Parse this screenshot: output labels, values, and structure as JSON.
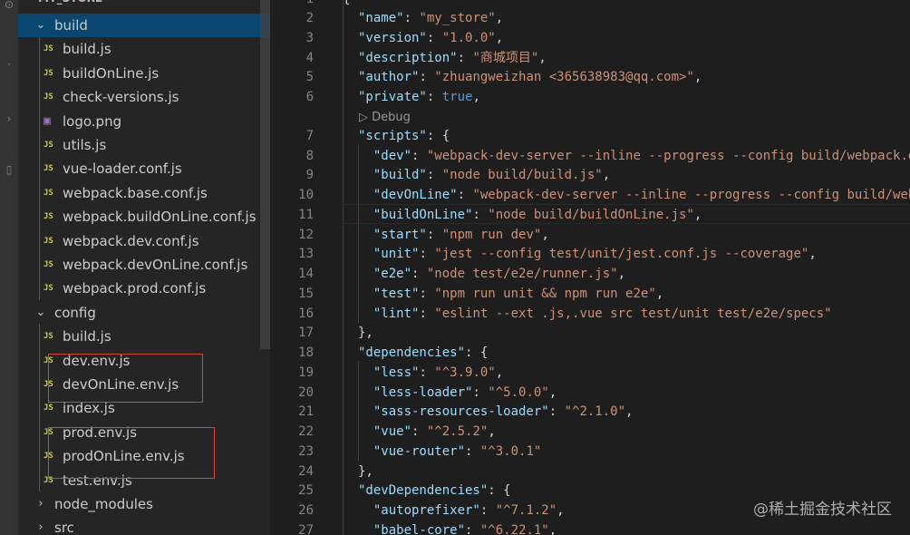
{
  "explorer": {
    "root_label": "MY_STORE",
    "items": [
      {
        "type": "folder",
        "label": "build",
        "open": true,
        "depth": 0,
        "selected": true
      },
      {
        "type": "js",
        "label": "build.js",
        "depth": 1
      },
      {
        "type": "js",
        "label": "buildOnLine.js",
        "depth": 1
      },
      {
        "type": "js",
        "label": "check-versions.js",
        "depth": 1
      },
      {
        "type": "png",
        "label": "logo.png",
        "depth": 1
      },
      {
        "type": "js",
        "label": "utils.js",
        "depth": 1
      },
      {
        "type": "js",
        "label": "vue-loader.conf.js",
        "depth": 1
      },
      {
        "type": "js",
        "label": "webpack.base.conf.js",
        "depth": 1
      },
      {
        "type": "js",
        "label": "webpack.buildOnLine.conf.js",
        "depth": 1
      },
      {
        "type": "js",
        "label": "webpack.dev.conf.js",
        "depth": 1
      },
      {
        "type": "js",
        "label": "webpack.devOnLine.conf.js",
        "depth": 1
      },
      {
        "type": "js",
        "label": "webpack.prod.conf.js",
        "depth": 1
      },
      {
        "type": "folder",
        "label": "config",
        "open": true,
        "depth": 0
      },
      {
        "type": "js",
        "label": "build.js",
        "depth": 1
      },
      {
        "type": "js",
        "label": "dev.env.js",
        "depth": 1
      },
      {
        "type": "js",
        "label": "devOnLine.env.js",
        "depth": 1
      },
      {
        "type": "js",
        "label": "index.js",
        "depth": 1
      },
      {
        "type": "js",
        "label": "prod.env.js",
        "depth": 1
      },
      {
        "type": "js",
        "label": "prodOnLine.env.js",
        "depth": 1
      },
      {
        "type": "js",
        "label": "test.env.js",
        "depth": 1
      },
      {
        "type": "folder",
        "label": "node_modules",
        "open": false,
        "depth": 0
      },
      {
        "type": "folder",
        "label": "src",
        "open": false,
        "depth": 0
      }
    ],
    "js_icon_text": "JS"
  },
  "codelens": "▷ Debug",
  "code_lines": [
    {
      "n": "2",
      "parts": [
        [
          "k",
          "\"name\""
        ],
        [
          "p",
          ": "
        ],
        [
          "s",
          "\"my_store\""
        ],
        [
          "p",
          ","
        ]
      ]
    },
    {
      "n": "3",
      "parts": [
        [
          "k",
          "\"version\""
        ],
        [
          "p",
          ": "
        ],
        [
          "s",
          "\"1.0.0\""
        ],
        [
          "p",
          ","
        ]
      ]
    },
    {
      "n": "4",
      "parts": [
        [
          "k",
          "\"description\""
        ],
        [
          "p",
          ": "
        ],
        [
          "s",
          "\"商城项目\""
        ],
        [
          "p",
          ","
        ]
      ]
    },
    {
      "n": "5",
      "parts": [
        [
          "k",
          "\"author\""
        ],
        [
          "p",
          ": "
        ],
        [
          "s",
          "\"zhuangweizhan <365638983@qq.com>\""
        ],
        [
          "p",
          ","
        ]
      ]
    },
    {
      "n": "6",
      "parts": [
        [
          "k",
          "\"private\""
        ],
        [
          "p",
          ": "
        ],
        [
          "b",
          "true"
        ],
        [
          "p",
          ","
        ]
      ]
    },
    {
      "n": "7",
      "parts": [
        [
          "k",
          "\"scripts\""
        ],
        [
          "p",
          ": {"
        ]
      ]
    },
    {
      "n": "8",
      "parts": [
        [
          "p",
          "  "
        ],
        [
          "k",
          "\"dev\""
        ],
        [
          "p",
          ": "
        ],
        [
          "s",
          "\"webpack-dev-server --inline --progress --config build/webpack.dev.conf.js\""
        ],
        [
          "p",
          ","
        ]
      ]
    },
    {
      "n": "9",
      "parts": [
        [
          "p",
          "  "
        ],
        [
          "k",
          "\"build\""
        ],
        [
          "p",
          ": "
        ],
        [
          "s",
          "\"node build/build.js\""
        ],
        [
          "p",
          ","
        ]
      ]
    },
    {
      "n": "10",
      "parts": [
        [
          "p",
          "  "
        ],
        [
          "k",
          "\"devOnLine\""
        ],
        [
          "p",
          ": "
        ],
        [
          "s",
          "\"webpack-dev-server --inline --progress --config build/webpack.devOnLine.conf.js\""
        ],
        [
          "p",
          ","
        ]
      ]
    },
    {
      "n": "11",
      "parts": [
        [
          "p",
          "  "
        ],
        [
          "k",
          "\"buildOnLine\""
        ],
        [
          "p",
          ": "
        ],
        [
          "s",
          "\"node build/buildOnLine.js\""
        ],
        [
          "p",
          ","
        ]
      ]
    },
    {
      "n": "12",
      "parts": [
        [
          "p",
          "  "
        ],
        [
          "k",
          "\"start\""
        ],
        [
          "p",
          ": "
        ],
        [
          "s",
          "\"npm run dev\""
        ],
        [
          "p",
          ","
        ]
      ]
    },
    {
      "n": "13",
      "parts": [
        [
          "p",
          "  "
        ],
        [
          "k",
          "\"unit\""
        ],
        [
          "p",
          ": "
        ],
        [
          "s",
          "\"jest --config test/unit/jest.conf.js --coverage\""
        ],
        [
          "p",
          ","
        ]
      ]
    },
    {
      "n": "14",
      "parts": [
        [
          "p",
          "  "
        ],
        [
          "k",
          "\"e2e\""
        ],
        [
          "p",
          ": "
        ],
        [
          "s",
          "\"node test/e2e/runner.js\""
        ],
        [
          "p",
          ","
        ]
      ]
    },
    {
      "n": "15",
      "parts": [
        [
          "p",
          "  "
        ],
        [
          "k",
          "\"test\""
        ],
        [
          "p",
          ": "
        ],
        [
          "s",
          "\"npm run unit && npm run e2e\""
        ],
        [
          "p",
          ","
        ]
      ]
    },
    {
      "n": "16",
      "parts": [
        [
          "p",
          "  "
        ],
        [
          "k",
          "\"lint\""
        ],
        [
          "p",
          ": "
        ],
        [
          "s",
          "\"eslint --ext .js,.vue src test/unit test/e2e/specs\""
        ]
      ]
    },
    {
      "n": "17",
      "parts": [
        [
          "p",
          "},"
        ]
      ]
    },
    {
      "n": "18",
      "parts": [
        [
          "k",
          "\"dependencies\""
        ],
        [
          "p",
          ": {"
        ]
      ]
    },
    {
      "n": "19",
      "parts": [
        [
          "p",
          "  "
        ],
        [
          "k",
          "\"less\""
        ],
        [
          "p",
          ": "
        ],
        [
          "s",
          "\"^3.9.0\""
        ],
        [
          "p",
          ","
        ]
      ]
    },
    {
      "n": "20",
      "parts": [
        [
          "p",
          "  "
        ],
        [
          "k",
          "\"less-loader\""
        ],
        [
          "p",
          ": "
        ],
        [
          "s",
          "\"^5.0.0\""
        ],
        [
          "p",
          ","
        ]
      ]
    },
    {
      "n": "21",
      "parts": [
        [
          "p",
          "  "
        ],
        [
          "k",
          "\"sass-resources-loader\""
        ],
        [
          "p",
          ": "
        ],
        [
          "s",
          "\"^2.1.0\""
        ],
        [
          "p",
          ","
        ]
      ]
    },
    {
      "n": "22",
      "parts": [
        [
          "p",
          "  "
        ],
        [
          "k",
          "\"vue\""
        ],
        [
          "p",
          ": "
        ],
        [
          "s",
          "\"^2.5.2\""
        ],
        [
          "p",
          ","
        ]
      ]
    },
    {
      "n": "23",
      "parts": [
        [
          "p",
          "  "
        ],
        [
          "k",
          "\"vue-router\""
        ],
        [
          "p",
          ": "
        ],
        [
          "s",
          "\"^3.0.1\""
        ]
      ]
    },
    {
      "n": "24",
      "parts": [
        [
          "p",
          "},"
        ]
      ]
    },
    {
      "n": "25",
      "parts": [
        [
          "k",
          "\"devDependencies\""
        ],
        [
          "p",
          ": {"
        ]
      ]
    },
    {
      "n": "26",
      "parts": [
        [
          "p",
          "  "
        ],
        [
          "k",
          "\"autoprefixer\""
        ],
        [
          "p",
          ": "
        ],
        [
          "s",
          "\"^7.1.2\""
        ],
        [
          "p",
          ","
        ]
      ]
    },
    {
      "n": "27",
      "parts": [
        [
          "p",
          "  "
        ],
        [
          "k",
          "\"babel-core\""
        ],
        [
          "p",
          ": "
        ],
        [
          "s",
          "\"^6.22.1\""
        ],
        [
          "p",
          ","
        ]
      ]
    }
  ],
  "first_line": {
    "n": "1",
    "text": "{"
  },
  "watermark": "@稀土掘金技术社区",
  "colors": {
    "key": "#9cdcfe",
    "string": "#ce9178",
    "bool": "#569cd6",
    "selection": "#094771",
    "highlight_box": "#e0403a"
  }
}
